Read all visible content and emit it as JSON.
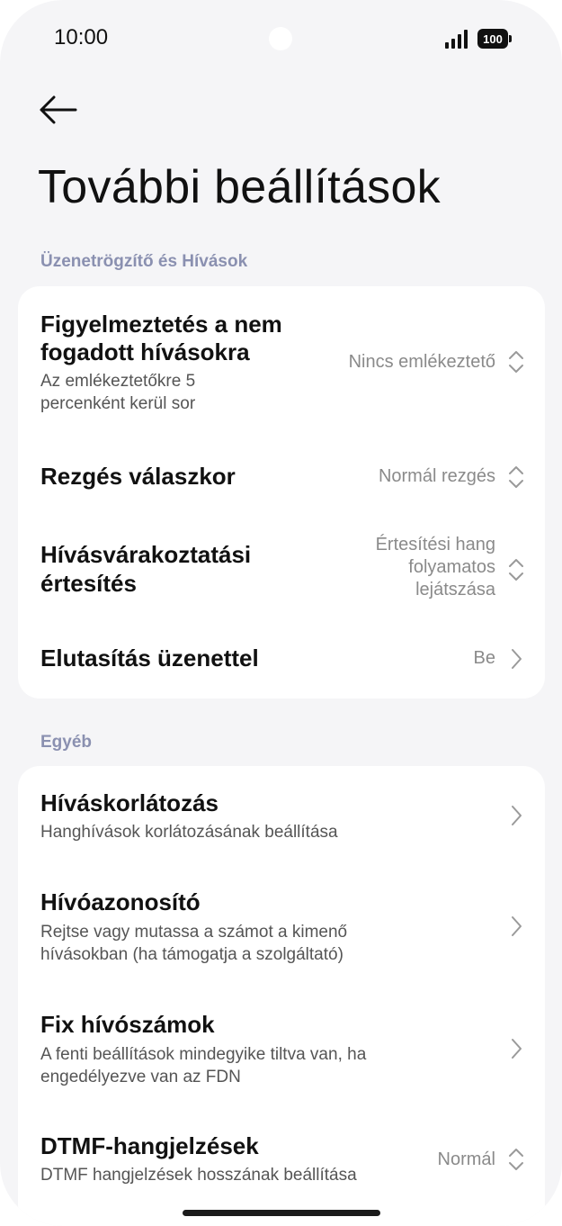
{
  "status": {
    "time": "10:00",
    "battery": "100"
  },
  "page": {
    "title": "További beállítások"
  },
  "sections": [
    {
      "header": "Üzenetrögzítő és Hívások",
      "rows": [
        {
          "title_l1": "Figyelmeztetés a nem",
          "title_l2": "fogadott hívásokra",
          "sub_l1": "Az emlékeztetőkre 5",
          "sub_l2": "percenként kerül sor",
          "value": "Nincs emlékeztető",
          "icon": "up-down-chevron-icon"
        },
        {
          "title_l1": "Rezgés válaszkor",
          "value": "Normál rezgés",
          "icon": "up-down-chevron-icon"
        },
        {
          "title_l1": "Hívásvárakoztatási",
          "title_l2": "értesítés",
          "value_l1": "Értesítési hang",
          "value_l2": "folyamatos",
          "value_l3": "lejátszása",
          "icon": "up-down-chevron-icon"
        },
        {
          "title_l1": "Elutasítás üzenettel",
          "value": "Be",
          "icon": "chevron-right-icon"
        }
      ]
    },
    {
      "header": "Egyéb",
      "rows": [
        {
          "title": "Híváskorlátozás",
          "sub_l1": "Hanghívások korlátozásának beállítása",
          "icon": "chevron-right-icon"
        },
        {
          "title": "Hívóazonosító",
          "sub_l1": "Rejtse vagy mutassa a számot a kimenő",
          "sub_l2": "hívásokban (ha támogatja a szolgáltató)",
          "icon": "chevron-right-icon"
        },
        {
          "title": "Fix hívószámok",
          "sub_l1": "A fenti beállítások mindegyike tiltva van, ha",
          "sub_l2": "engedélyezve van az FDN",
          "icon": "chevron-right-icon"
        },
        {
          "title": "DTMF-hangjelzések",
          "sub_l1": "DTMF hangjelzések hosszának beállítása",
          "value": "Normál",
          "icon": "up-down-chevron-icon"
        }
      ]
    }
  ]
}
